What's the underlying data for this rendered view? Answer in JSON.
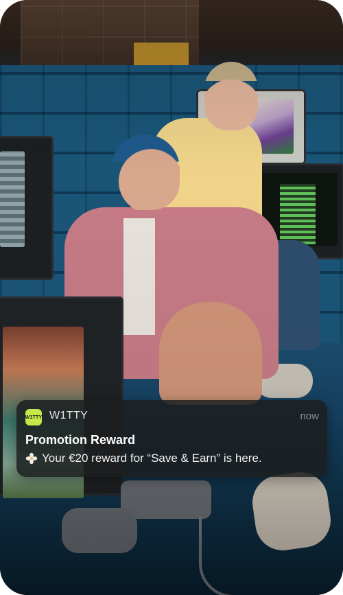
{
  "notification": {
    "app_icon_text": "W1TTY",
    "app_name": "W1TTY",
    "time": "now",
    "title": "Promotion Reward",
    "message": "Your €20 reward for “Save & Earn” is here.",
    "message_icon": "flower-icon"
  },
  "colors": {
    "app_icon_bg": "#c6e84a",
    "notification_bg": "#1c1e20",
    "time_text": "#8c8d90"
  }
}
